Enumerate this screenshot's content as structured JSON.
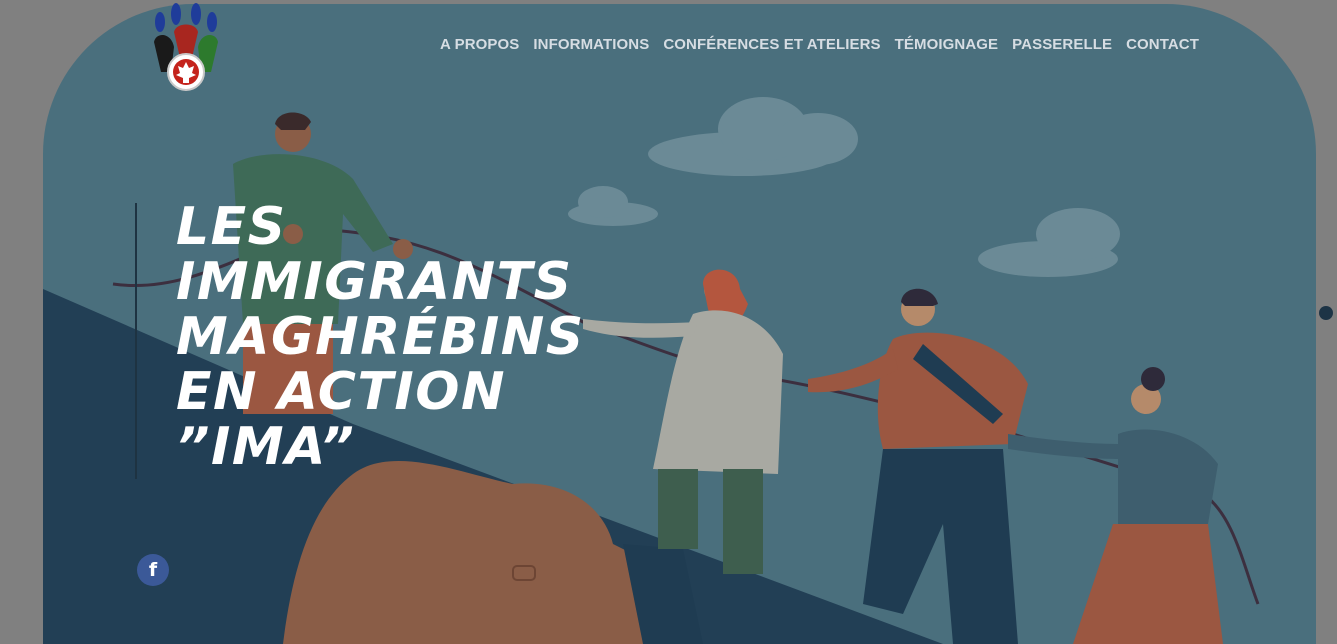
{
  "brand": {
    "logo_icon": "maple-leaf-people-logo-icon"
  },
  "nav": {
    "items": [
      {
        "label": "A PROPOS"
      },
      {
        "label": "INFORMATIONS"
      },
      {
        "label": "CONFÉRENCES ET ATELIERS"
      },
      {
        "label": "TÉMOIGNAGE"
      },
      {
        "label": "PASSERELLE"
      },
      {
        "label": "CONTACT"
      }
    ]
  },
  "hero": {
    "title_lines": [
      "LES",
      "IMMIGRANTS",
      "MAGHRÉBINS",
      "EN ACTION",
      "”IMA”"
    ],
    "illustration": "people-climbing-rope-on-hand-illustration"
  },
  "social": {
    "facebook_label": "f"
  },
  "colors": {
    "background": "#808080",
    "hero": "#4a6f7d",
    "nav_text": "#d6dde3",
    "title": "#ffffff",
    "facebook": "#3b5998",
    "accent_dark": "#1d3446"
  }
}
